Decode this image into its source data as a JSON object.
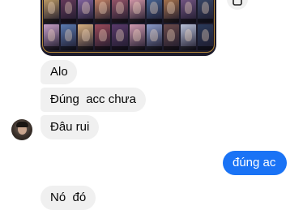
{
  "shared_image": {
    "description_icon": "game-skins-screenshot",
    "skin_colors": [
      "#c7a46a",
      "#6b3c5e",
      "#8b6aa8",
      "#d08a6a",
      "#a05a6e",
      "#e0a0b0",
      "#4a6a9a",
      "#b07a50",
      "#7a5a8a",
      "#3a4a6a",
      "#c6a0c8",
      "#5a7ab0",
      "#d8b080",
      "#9a4a5a",
      "#5a3a6a",
      "#d09ab0",
      "#8a9ac8",
      "#6a4a4a",
      "#b8c0d8",
      "#2a3a5a"
    ]
  },
  "share_icon": "forward-icon",
  "messages": [
    {
      "text": "Alo",
      "side": "incoming"
    },
    {
      "text": "Đúng  acc chưa",
      "side": "incoming"
    },
    {
      "text": "Đâu rui",
      "side": "incoming"
    },
    {
      "text": "đúng ac",
      "side": "outgoing"
    },
    {
      "text": "Nó  đó",
      "side": "incoming"
    }
  ],
  "colors": {
    "outgoing_bubble": "#1a73f5",
    "incoming_bubble": "#f0f0f0"
  }
}
